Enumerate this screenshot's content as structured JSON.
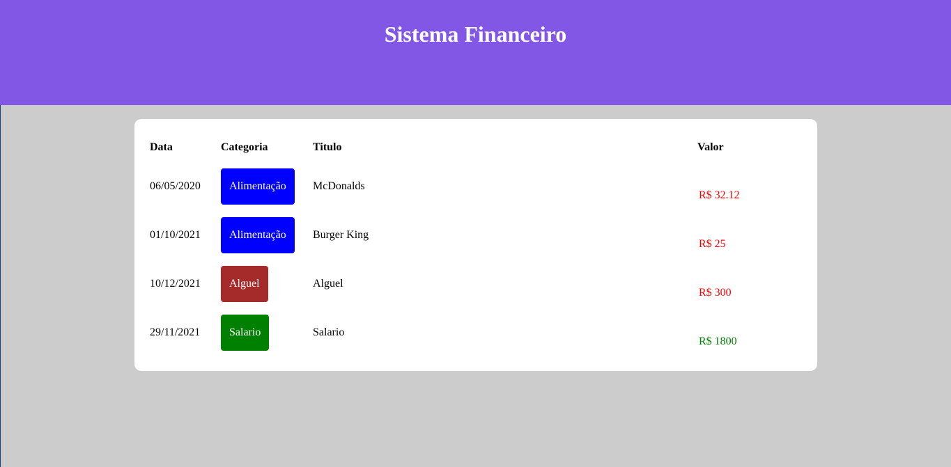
{
  "header": {
    "title": "Sistema Financeiro"
  },
  "table": {
    "columns": {
      "date": "Data",
      "category": "Categoria",
      "title": "Titulo",
      "value": "Valor"
    },
    "rows": [
      {
        "date": "06/05/2020",
        "category": "Alimentação",
        "category_color": "#0000ff",
        "title": "McDonalds",
        "value": "R$ 32.12",
        "value_color": "#ff0000"
      },
      {
        "date": "01/10/2021",
        "category": "Alimentação",
        "category_color": "#0000ff",
        "title": "Burger King",
        "value": "R$ 25",
        "value_color": "#ff0000"
      },
      {
        "date": "10/12/2021",
        "category": "Alguel",
        "category_color": "#a52a2a",
        "title": "Alguel",
        "value": "R$ 300",
        "value_color": "#ff0000"
      },
      {
        "date": "29/11/2021",
        "category": "Salario",
        "category_color": "#008000",
        "title": "Salario",
        "value": "R$ 1800",
        "value_color": "#008000"
      }
    ]
  },
  "colors": {
    "header_bg": "#8257e6",
    "page_bg": "#cccccc",
    "card_bg": "#ffffff"
  }
}
